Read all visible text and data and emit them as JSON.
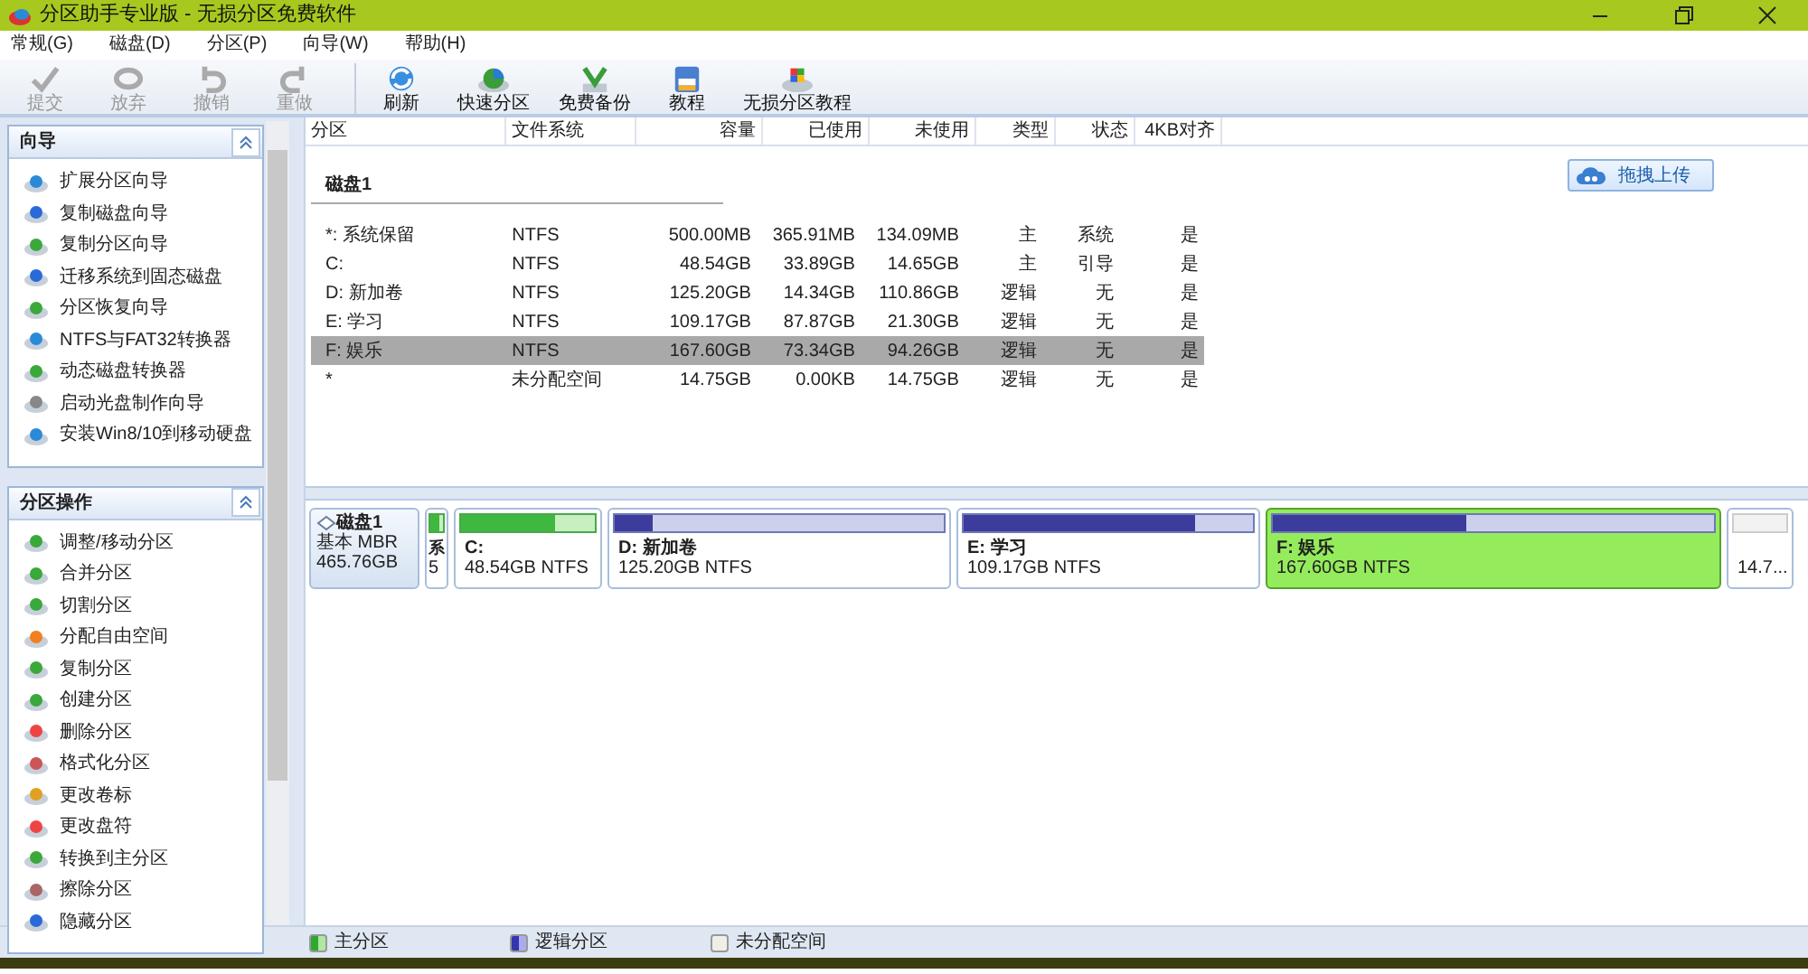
{
  "window": {
    "title": "分区助手专业版 - 无损分区免费软件"
  },
  "menu": [
    "常规(G)",
    "磁盘(D)",
    "分区(P)",
    "向导(W)",
    "帮助(H)"
  ],
  "toolbar": [
    {
      "label": "提交",
      "disabled": true
    },
    {
      "label": "放弃",
      "disabled": true
    },
    {
      "label": "撤销",
      "disabled": true
    },
    {
      "label": "重做",
      "disabled": true
    },
    {
      "label": "刷新",
      "disabled": false
    },
    {
      "label": "快速分区",
      "disabled": false
    },
    {
      "label": "免费备份",
      "disabled": false
    },
    {
      "label": "教程",
      "disabled": false
    },
    {
      "label": "无损分区教程",
      "disabled": false
    }
  ],
  "sidebar": [
    {
      "title": "向导",
      "items": [
        "扩展分区向导",
        "复制磁盘向导",
        "复制分区向导",
        "迁移系统到固态磁盘",
        "分区恢复向导",
        "NTFS与FAT32转换器",
        "动态磁盘转换器",
        "启动光盘制作向导",
        "安装Win8/10到移动硬盘"
      ]
    },
    {
      "title": "分区操作",
      "items": [
        "调整/移动分区",
        "合并分区",
        "切割分区",
        "分配自由空间",
        "复制分区",
        "创建分区",
        "删除分区",
        "格式化分区",
        "更改卷标",
        "更改盘符",
        "转换到主分区",
        "擦除分区",
        "隐藏分区"
      ]
    }
  ],
  "table": {
    "columns": [
      "分区",
      "文件系统",
      "容量",
      "已使用",
      "未使用",
      "类型",
      "状态",
      "4KB对齐"
    ],
    "disk_label": "磁盘1",
    "rows": [
      {
        "cells": [
          "*: 系统保留",
          "NTFS",
          "500.00MB",
          "365.91MB",
          "134.09MB",
          "主",
          "系统",
          "是"
        ],
        "selected": false
      },
      {
        "cells": [
          "C:",
          "NTFS",
          "48.54GB",
          "33.89GB",
          "14.65GB",
          "主",
          "引导",
          "是"
        ],
        "selected": false
      },
      {
        "cells": [
          "D: 新加卷",
          "NTFS",
          "125.20GB",
          "14.34GB",
          "110.86GB",
          "逻辑",
          "无",
          "是"
        ],
        "selected": false
      },
      {
        "cells": [
          "E: 学习",
          "NTFS",
          "109.17GB",
          "87.87GB",
          "21.30GB",
          "逻辑",
          "无",
          "是"
        ],
        "selected": false
      },
      {
        "cells": [
          "F: 娱乐",
          "NTFS",
          "167.60GB",
          "73.34GB",
          "94.26GB",
          "逻辑",
          "无",
          "是"
        ],
        "selected": true
      },
      {
        "cells": [
          "*",
          "未分配空间",
          "14.75GB",
          "0.00KB",
          "14.75GB",
          "逻辑",
          "无",
          "是"
        ],
        "selected": false
      }
    ]
  },
  "upload_button": "拖拽上传",
  "disk_map": {
    "disk": {
      "name": "磁盘1",
      "type": "基本 MBR",
      "size": "465.76GB"
    },
    "partitions": [
      {
        "kind": "primary",
        "name": "系",
        "info": "5",
        "level": 0.73,
        "selected": false
      },
      {
        "kind": "primary",
        "name": "C:",
        "info": "48.54GB NTFS",
        "level": 0.7,
        "selected": false
      },
      {
        "kind": "logical",
        "name": "D: 新加卷",
        "info": "125.20GB NTFS",
        "level": 0.115,
        "selected": false
      },
      {
        "kind": "logical",
        "name": "E: 学习",
        "info": "109.17GB NTFS",
        "level": 0.8,
        "selected": false
      },
      {
        "kind": "logical",
        "name": "F: 娱乐",
        "info": "167.60GB NTFS",
        "level": 0.44,
        "selected": true
      },
      {
        "kind": "unallocated",
        "info": "14.7...",
        "selected": false
      }
    ]
  },
  "legend": [
    {
      "kind": "primary",
      "label": "主分区"
    },
    {
      "kind": "logical",
      "label": "逻辑分区"
    },
    {
      "kind": "unallocated",
      "label": "未分配空间"
    }
  ]
}
